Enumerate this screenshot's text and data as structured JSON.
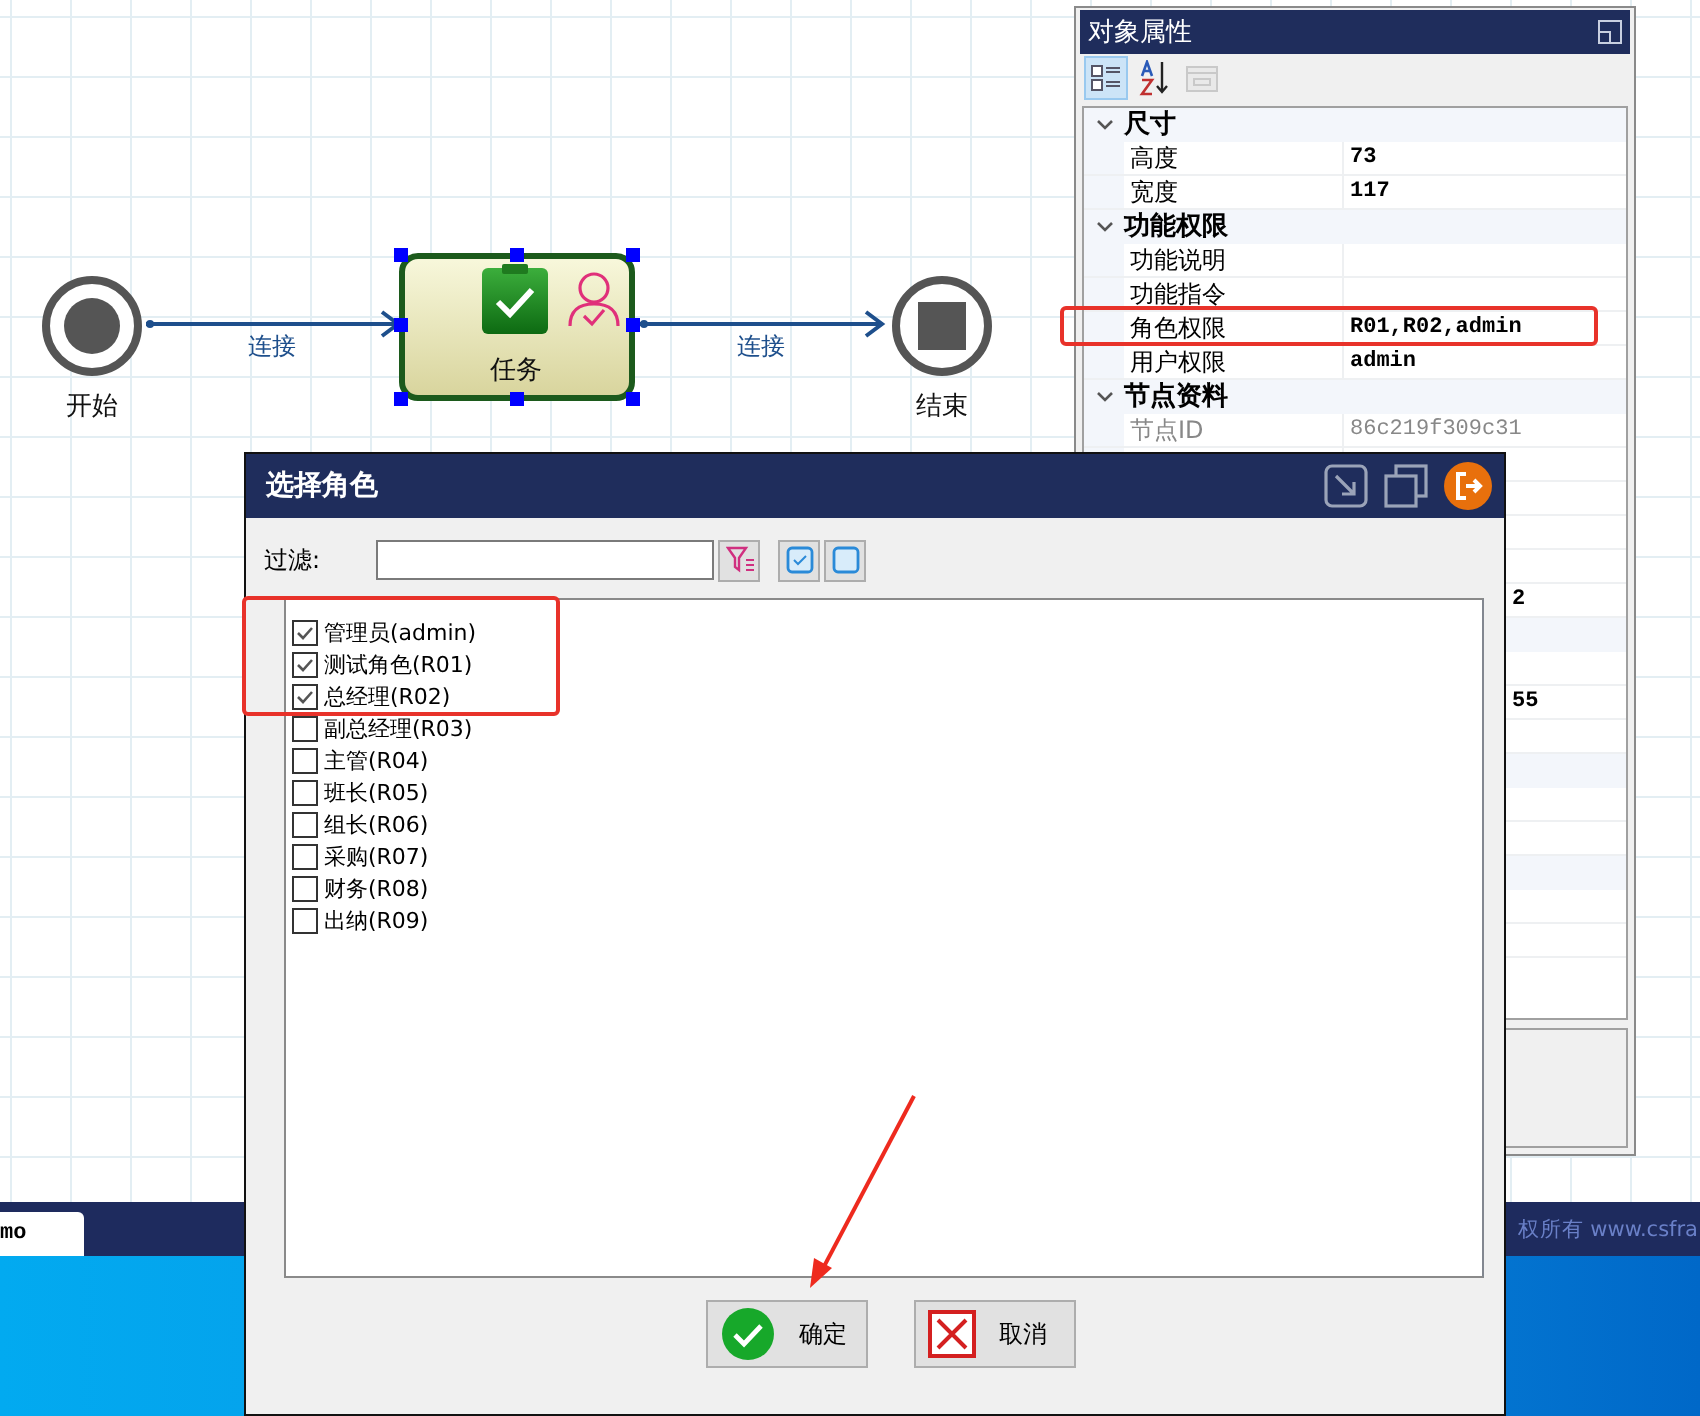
{
  "canvas": {
    "nodes": [
      {
        "kind": "start",
        "label": "开始"
      },
      {
        "kind": "task",
        "label": "任务",
        "selected": true
      },
      {
        "kind": "end",
        "label": "结束"
      }
    ],
    "links": [
      {
        "label": "连接"
      },
      {
        "label": "连接"
      }
    ]
  },
  "property_panel": {
    "title": "对象属性",
    "toolbar": [
      {
        "kind": "categorized",
        "selected": true,
        "disabled": false
      },
      {
        "kind": "alphabetical",
        "selected": false,
        "disabled": false
      },
      {
        "kind": "pages",
        "selected": false,
        "disabled": true
      }
    ],
    "rows": [
      {
        "kind": "category",
        "label": "尺寸",
        "expanded": true
      },
      {
        "kind": "property",
        "label": "高度",
        "value": "73"
      },
      {
        "kind": "property",
        "label": "宽度",
        "value": "117"
      },
      {
        "kind": "category",
        "label": "功能权限",
        "expanded": true
      },
      {
        "kind": "property",
        "label": "功能说明"
      },
      {
        "kind": "property",
        "label": "功能指令"
      },
      {
        "kind": "property",
        "label": "角色权限",
        "value": "R01,R02,admin",
        "highlighted": true
      },
      {
        "kind": "property",
        "label": "用户权限",
        "value": "admin"
      },
      {
        "kind": "category",
        "label": "节点资料",
        "expanded": true
      },
      {
        "kind": "property",
        "label": "节点ID",
        "value": "86c219f309c31",
        "readonly": true
      }
    ],
    "covered_rows": [
      {
        "kind": "property"
      },
      {
        "kind": "property"
      },
      {
        "kind": "property"
      },
      {
        "kind": "property"
      },
      {
        "kind": "property",
        "value": "2"
      },
      {
        "kind": "category"
      },
      {
        "kind": "property"
      },
      {
        "kind": "property",
        "value": "55"
      },
      {
        "kind": "property"
      },
      {
        "kind": "category"
      },
      {
        "kind": "property"
      },
      {
        "kind": "property"
      },
      {
        "kind": "category"
      },
      {
        "kind": "property"
      },
      {
        "kind": "property"
      }
    ]
  },
  "role_dialog": {
    "title": "选择角色",
    "filter_label": "过滤:",
    "items": [
      {
        "label": "管理员(admin)",
        "checked": true,
        "highlighted": true
      },
      {
        "label": "测试角色(R01)",
        "checked": true,
        "highlighted": true
      },
      {
        "label": "总经理(R02)",
        "checked": true,
        "highlighted": true
      },
      {
        "label": "副总经理(R03)",
        "checked": false,
        "highlighted": false
      },
      {
        "label": "主管(R04)",
        "checked": false,
        "highlighted": false
      },
      {
        "label": "班长(R05)",
        "checked": false,
        "highlighted": false
      },
      {
        "label": "组长(R06)",
        "checked": false,
        "highlighted": false
      },
      {
        "label": "采购(R07)",
        "checked": false,
        "highlighted": false
      },
      {
        "label": "财务(R08)",
        "checked": false,
        "highlighted": false
      },
      {
        "label": "出纳(R09)",
        "checked": false,
        "highlighted": false
      }
    ],
    "buttons": [
      {
        "kind": "ok",
        "label": "确定"
      },
      {
        "kind": "cancel",
        "label": "取消"
      }
    ]
  },
  "taskbar": {
    "tab": "mo",
    "footer_text": "权所有 www.csfra"
  }
}
